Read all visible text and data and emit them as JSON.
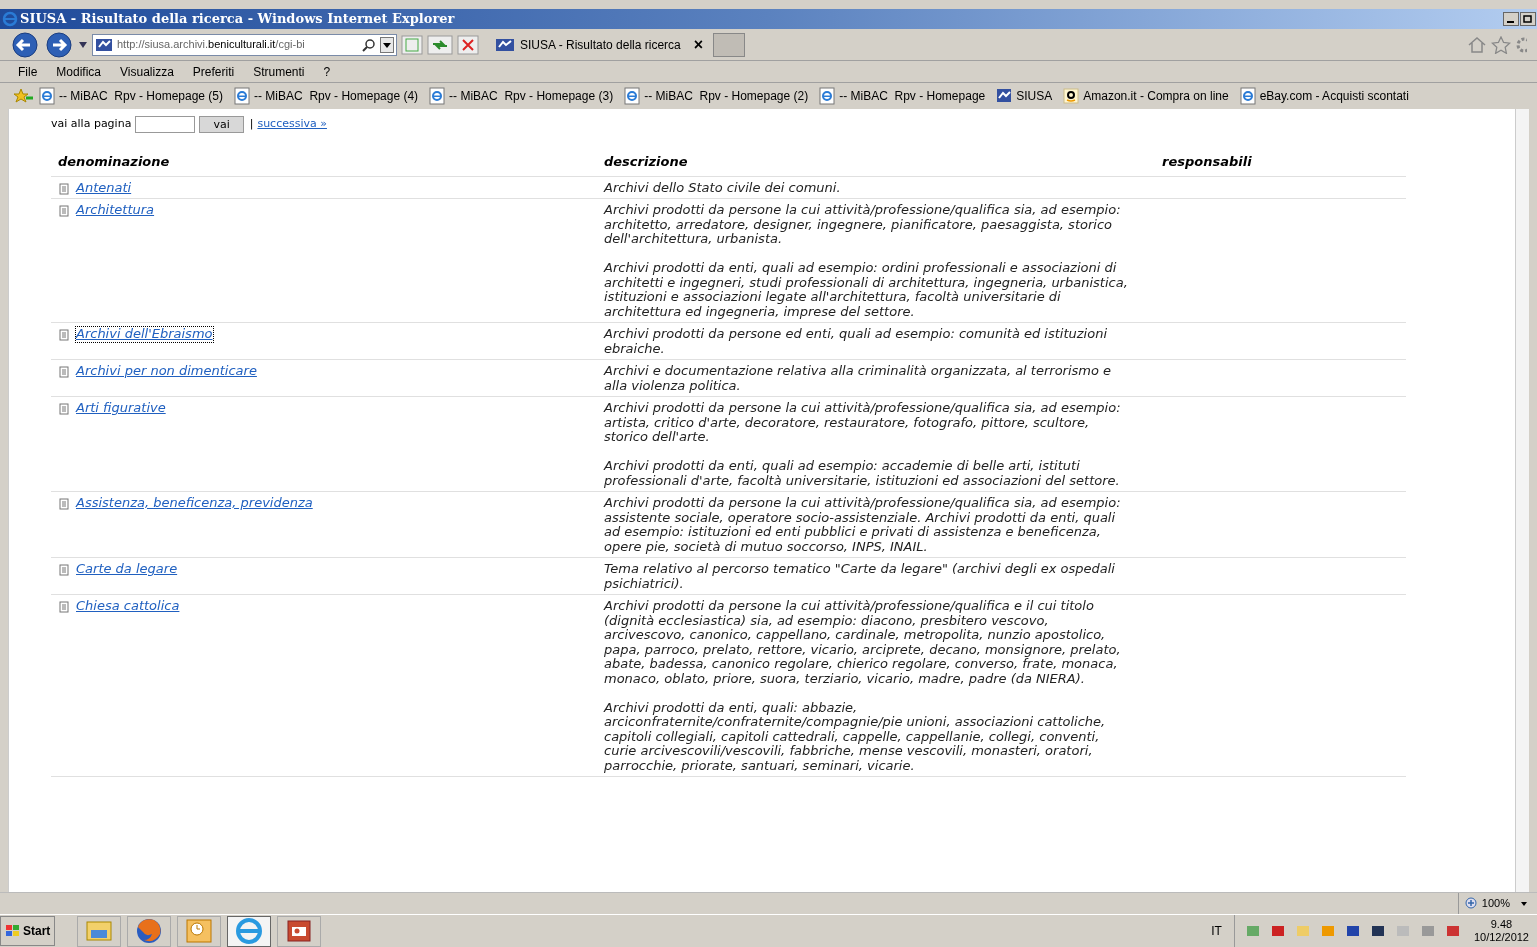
{
  "window": {
    "title": "SIUSA - Risultato della ricerca - Windows Internet Explorer"
  },
  "address_bar": {
    "url_prefix": "http://siusa.archivi.",
    "url_domain": "beniculturali.it",
    "url_suffix": "/cgi-bi"
  },
  "tabs": [
    {
      "label": "SIUSA - Risultato della ricerca",
      "selected": true,
      "close": "×"
    }
  ],
  "menu": [
    "File",
    "Modifica",
    "Visualizza",
    "Preferiti",
    "Strumenti",
    "?"
  ],
  "favorites": [
    {
      "kind": "ie",
      "label": "-- MiBAC  Rpv - Homepage (5)"
    },
    {
      "kind": "ie",
      "label": "-- MiBAC  Rpv - Homepage (4)"
    },
    {
      "kind": "ie",
      "label": "-- MiBAC  Rpv - Homepage (3)"
    },
    {
      "kind": "ie",
      "label": "-- MiBAC  Rpv - Homepage (2)"
    },
    {
      "kind": "ie",
      "label": "-- MiBAC  Rpv - Homepage"
    },
    {
      "kind": "siusa",
      "label": "SIUSA"
    },
    {
      "kind": "amazon",
      "label": "Amazon.it - Compra on line"
    },
    {
      "kind": "ie",
      "label": "eBay.com - Acquisti scontati"
    }
  ],
  "pager": {
    "label": "vai alla pagina",
    "button": "vai",
    "separator": "|",
    "next": "successiva »"
  },
  "table": {
    "columns": [
      "denominazione",
      "descrizione",
      "responsabili"
    ],
    "rows": [
      {
        "name": "Antenati",
        "focused": false,
        "description": [
          "Archivi dello Stato civile dei comuni."
        ]
      },
      {
        "name": "Architettura",
        "focused": false,
        "description": [
          "Archivi prodotti da persone la cui attività/professione/qualifica sia, ad esempio: architetto, arredatore, designer, ingegnere, pianificatore, paesaggista, storico dell'architettura, urbanista.",
          "Archivi prodotti da enti, quali ad esempio: ordini professionali e associazioni di architetti e ingegneri, studi professionali di architettura, ingegneria, urbanistica, istituzioni e associazioni legate all'architettura, facoltà universitarie di architettura ed ingegneria, imprese del settore."
        ]
      },
      {
        "name": "Archivi dell'Ebraismo",
        "focused": true,
        "description": [
          "Archivi prodotti da persone ed enti, quali ad esempio: comunità ed istituzioni ebraiche."
        ]
      },
      {
        "name": "Archivi per non dimenticare",
        "focused": false,
        "description": [
          "Archivi e documentazione relativa alla criminalità organizzata, al terrorismo e alla violenza politica."
        ]
      },
      {
        "name": "Arti figurative",
        "focused": false,
        "description": [
          "Archivi prodotti da persone la cui attività/professione/qualifica sia, ad esempio: artista, critico d'arte, decoratore, restauratore, fotografo, pittore, scultore, storico dell'arte.",
          "Archivi prodotti da enti, quali ad esempio: accademie di belle arti, istituti professionali d'arte, facoltà universitarie, istituzioni ed associazioni del settore."
        ]
      },
      {
        "name": "Assistenza, beneficenza, previdenza",
        "focused": false,
        "description": [
          "Archivi prodotti da persone la cui attività/professione/qualifica sia, ad esempio: assistente sociale, operatore socio-assistenziale. Archivi prodotti da enti, quali ad esempio: istituzioni ed enti pubblici e privati di assistenza e beneficenza, opere pie, società di mutuo soccorso, INPS, INAIL."
        ]
      },
      {
        "name": "Carte da legare",
        "focused": false,
        "description": [
          "Tema relativo al percorso tematico \"Carte da legare\" (archivi degli ex ospedali psichiatrici)."
        ]
      },
      {
        "name": "Chiesa cattolica",
        "focused": false,
        "description": [
          "Archivi prodotti da persone la cui attività/professione/qualifica e il cui titolo (dignità ecclesiastica) sia, ad esempio: diacono, presbitero vescovo, arcivescovo, canonico, cappellano, cardinale, metropolita, nunzio apostolico, papa, parroco, prelato, rettore, vicario, arciprete, decano, monsignore, prelato, abate, badessa, canonico regolare, chierico regolare, converso, frate, monaca, monaco, oblato, priore, suora, terziario, vicario, madre, padre (da NIERA).",
          "Archivi prodotti da enti, quali: abbazie, arciconfraternite/confraternite/compagnie/pie unioni, associazioni cattoliche, capitoli collegiali, capitoli cattedrali, cappelle, cappellanie, collegi, conventi, curie arcivescovili/vescovili, fabbriche, mense vescovili, monasteri, oratori, parrocchie, priorate, santuari, seminari, vicarie."
        ]
      }
    ]
  },
  "status_bar": {
    "zoom": "100%"
  },
  "taskbar": {
    "start": "Start",
    "apps": [
      {
        "kind": "folder",
        "selected": false
      },
      {
        "kind": "firefox",
        "selected": false
      },
      {
        "kind": "calendar",
        "selected": false
      },
      {
        "kind": "ie",
        "selected": true
      },
      {
        "kind": "slides",
        "selected": false
      }
    ],
    "language": "IT",
    "time": "9.48",
    "date": "10/12/2012"
  }
}
